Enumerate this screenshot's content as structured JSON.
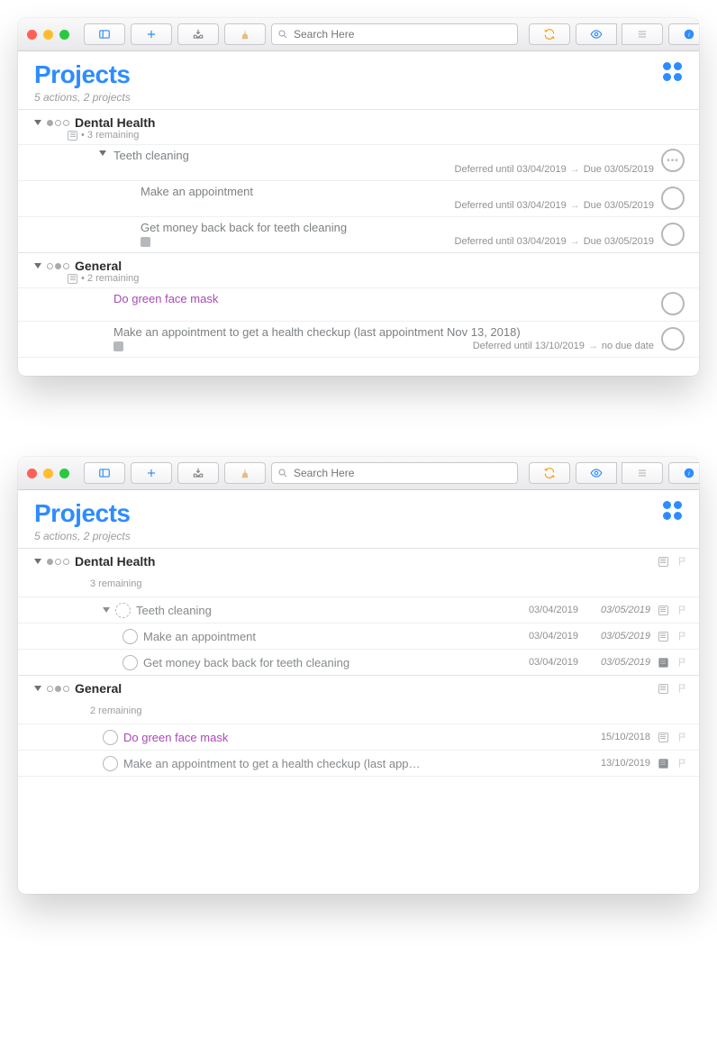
{
  "search_placeholder": "Search Here",
  "heading": "Projects",
  "subcount": "5 actions, 2 projects",
  "w1": {
    "projects": [
      {
        "name": "Dental Health",
        "remaining": "• 3 remaining",
        "tasks": [
          {
            "title": "Teeth cleaning",
            "deferred": "Deferred until 03/04/2019",
            "due": "Due 03/05/2019",
            "more": true,
            "tri": true
          },
          {
            "title": "Make an appointment",
            "deferred": "Deferred until 03/04/2019",
            "due": "Due 03/05/2019"
          },
          {
            "title": "Get money back back for teeth cleaning",
            "deferred": "Deferred until 03/04/2019",
            "due": "Due 03/05/2019",
            "note": true
          }
        ]
      },
      {
        "name": "General",
        "remaining": "• 2 remaining",
        "tasks": [
          {
            "title": "Do green face mask",
            "purple": true
          },
          {
            "title": "Make an appointment to get a health checkup (last appointment Nov 13, 2018)",
            "deferred": "Deferred until 13/10/2019",
            "due": "no due date",
            "note": true
          }
        ]
      }
    ]
  },
  "w2": {
    "projects": [
      {
        "name": "Dental Health",
        "remaining": "3 remaining",
        "tasks": [
          {
            "title": "Teeth cleaning",
            "d1": "03/04/2019",
            "d2": "03/05/2019",
            "dashed": true,
            "tri": true,
            "note": true
          },
          {
            "title": "Make an appointment",
            "d1": "03/04/2019",
            "d2": "03/05/2019",
            "note": true,
            "level": 3
          },
          {
            "title": "Get money back back for teeth cleaning",
            "d1": "03/04/2019",
            "d2": "03/05/2019",
            "note": true,
            "noteFilled": true,
            "level": 3
          }
        ]
      },
      {
        "name": "General",
        "remaining": "2 remaining",
        "tasks": [
          {
            "title": "Do green face mask",
            "d1": "",
            "d2": "15/10/2018",
            "purple": true,
            "note": true,
            "level": 2
          },
          {
            "title": "Make an appointment to get a health checkup (last app…",
            "d1": "",
            "d2": "13/10/2019",
            "note": true,
            "noteFilled": true,
            "level": 2
          }
        ]
      }
    ]
  }
}
